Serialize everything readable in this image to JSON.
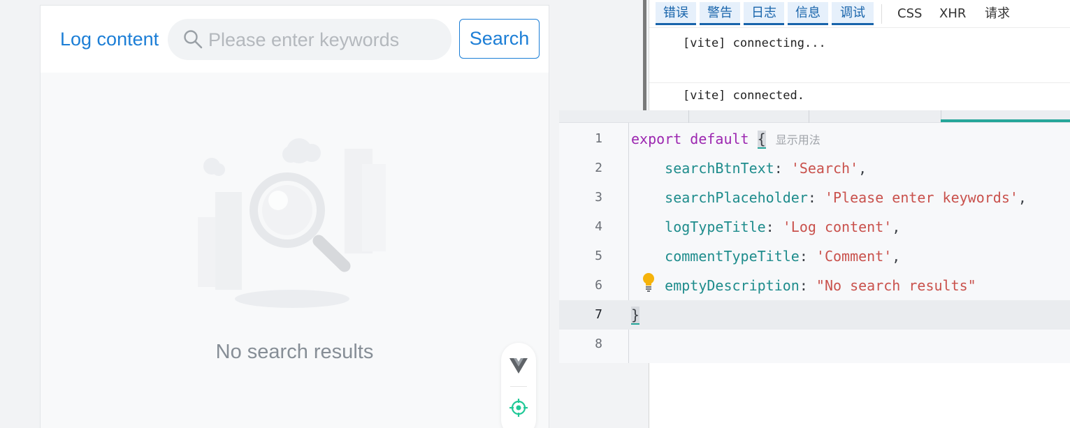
{
  "app": {
    "log_title": "Log content",
    "search_placeholder": "Please enter keywords",
    "search_value": "",
    "search_button": "Search",
    "empty_description": "No search results",
    "float_tools": [
      "vue-devtools-icon",
      "locate-target-icon"
    ]
  },
  "console": {
    "level_tabs": [
      "错误",
      "警告",
      "日志",
      "信息",
      "调试"
    ],
    "filter_tabs": [
      "CSS",
      "XHR",
      "请求"
    ],
    "lines": [
      "[vite] connecting...",
      "[vite] connected."
    ]
  },
  "editor": {
    "inlay_hint": "显示用法",
    "lines": [
      {
        "num": "1"
      },
      {
        "num": "2",
        "prop": "searchBtnText",
        "value": "'Search'",
        "tail": ","
      },
      {
        "num": "3",
        "prop": "searchPlaceholder",
        "value": "'Please enter keywords'",
        "tail": ","
      },
      {
        "num": "4",
        "prop": "logTypeTitle",
        "value": "'Log content'",
        "tail": ","
      },
      {
        "num": "5",
        "prop": "commentTypeTitle",
        "value": "'Comment'",
        "tail": ","
      },
      {
        "num": "6",
        "prop": "emptyDescription",
        "value": "\"No search results\"",
        "tail": ""
      },
      {
        "num": "7",
        "code": "}"
      },
      {
        "num": "8"
      }
    ],
    "keywords": [
      "export",
      "default"
    ],
    "open_brace": "{",
    "current_line": 7
  },
  "colors": {
    "accent": "#1c7ed6",
    "keyword": "#9c27b0",
    "property": "#1e8c8c",
    "string": "#c9514c",
    "active_tab": "#26a69a"
  }
}
